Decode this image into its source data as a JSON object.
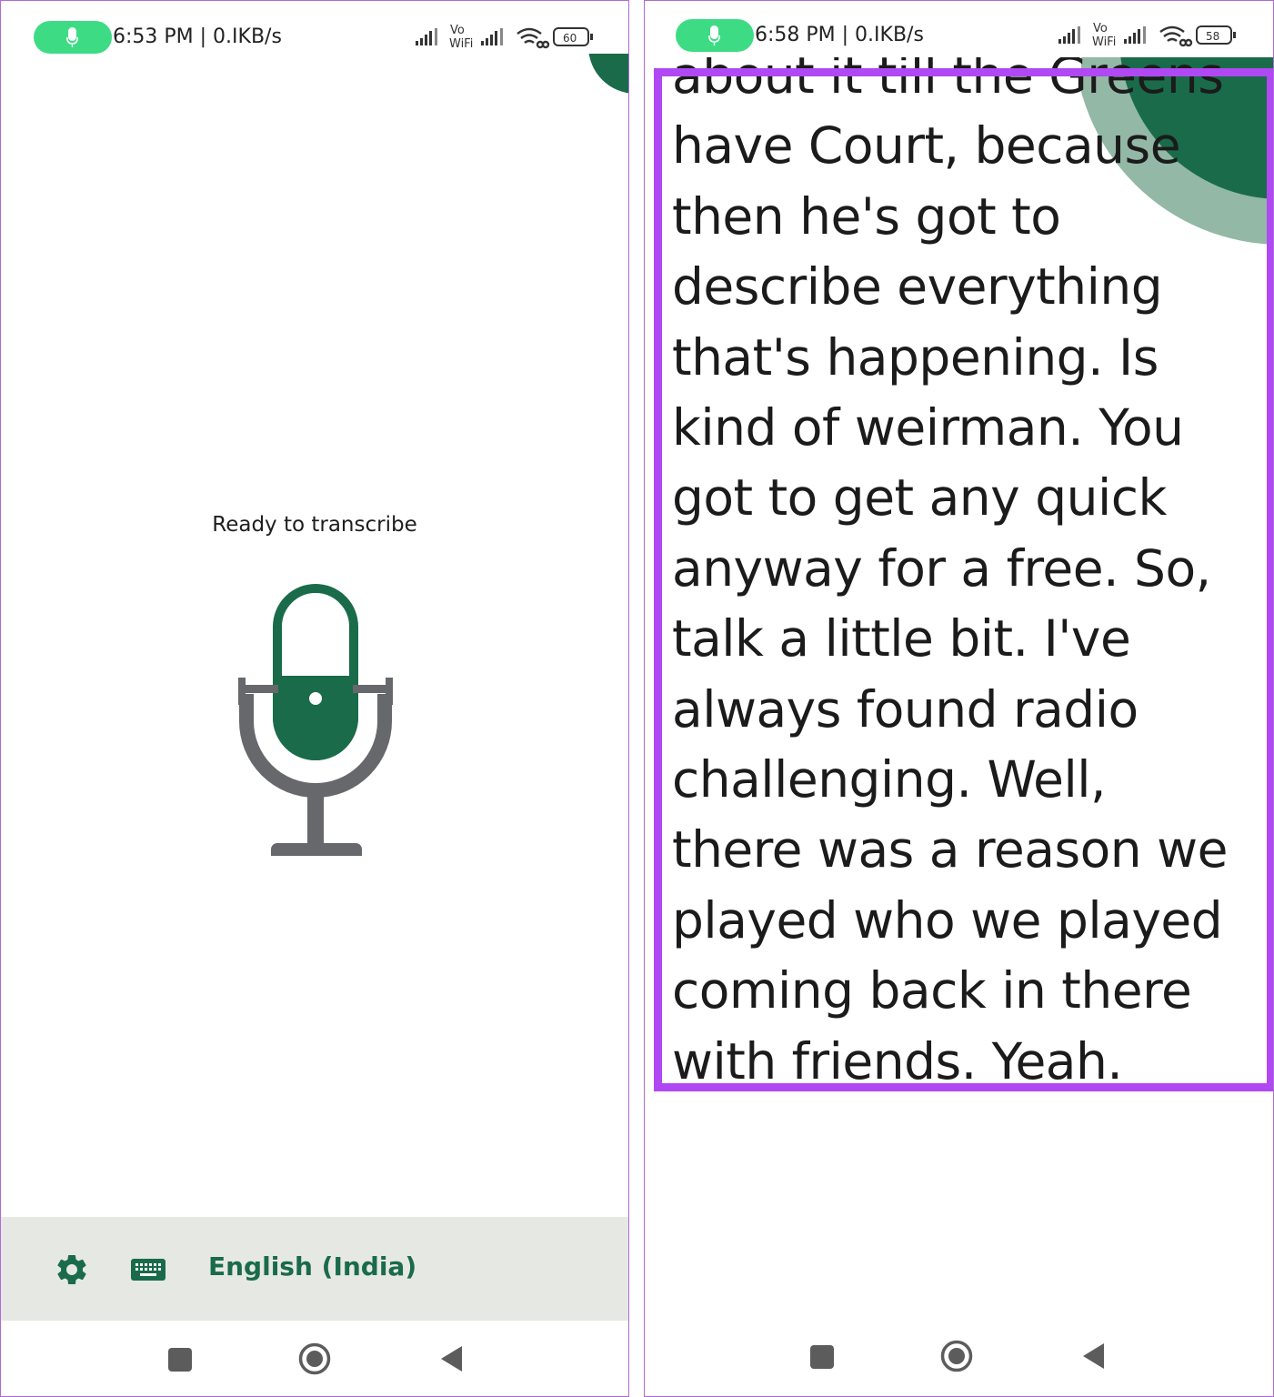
{
  "colors": {
    "brand_green": "#1a6b4a",
    "pill_green": "#3ddc84",
    "mic_grey": "#67686c",
    "bottom_bar_bg": "#e6e8e4",
    "highlight_purple": "#b048f4",
    "deco_light_green": "#93b8a6"
  },
  "left_screen": {
    "status": {
      "time_text": "6:53 PM | 0.IKB/s",
      "network_label_top": "Vo",
      "network_label_bottom": "WiFi",
      "battery_level": "60"
    },
    "ready_text": "Ready to transcribe",
    "bottom_bar": {
      "settings_icon": "gear-icon",
      "keyboard_icon": "keyboard-icon",
      "language": "English (India)"
    }
  },
  "right_screen": {
    "status": {
      "time_text": "6:58 PM | 0.IKB/s",
      "network_label_top": "Vo",
      "network_label_bottom": "WiFi",
      "battery_level": "58"
    },
    "transcript_lines": [
      "about it till the Greens",
      "have Court, because",
      "then he's got to",
      "describe everything",
      "that's happening. Is",
      "kind of weirman. You",
      "got to get any quick",
      "anyway for a free. So,",
      "talk a little bit. I've",
      "always found radio",
      "challenging. Well,",
      "there was a reason we",
      "played who we played",
      "coming back in there",
      "with friends. Yeah."
    ]
  },
  "navbar": {
    "recent_icon": "square-recents-icon",
    "home_icon": "circle-home-icon",
    "back_icon": "triangle-back-icon"
  }
}
